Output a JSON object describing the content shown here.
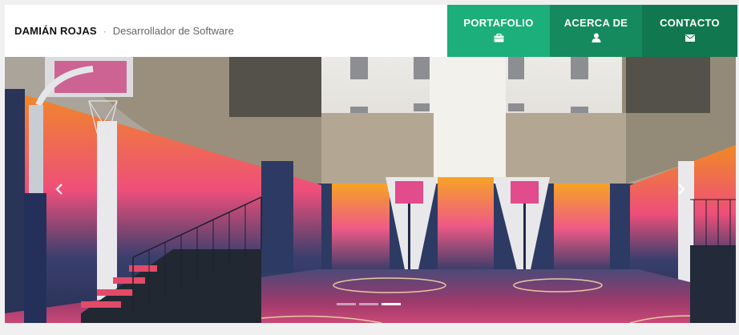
{
  "header": {
    "brand_name": "DAMIÁN ROJAS",
    "separator": "·",
    "brand_role": "Desarrollador de Software"
  },
  "nav": {
    "items": [
      {
        "label": "PORTAFOLIO",
        "icon": "briefcase-icon",
        "color": "#1cae7b"
      },
      {
        "label": "ACERCA DE",
        "icon": "user-icon",
        "color": "#158a5f"
      },
      {
        "label": "CONTACTO",
        "icon": "envelope-icon",
        "color": "#11774f"
      }
    ]
  },
  "carousel": {
    "image": "colorful-basketball-court-photo",
    "indicators": 3,
    "active_index": 2
  }
}
